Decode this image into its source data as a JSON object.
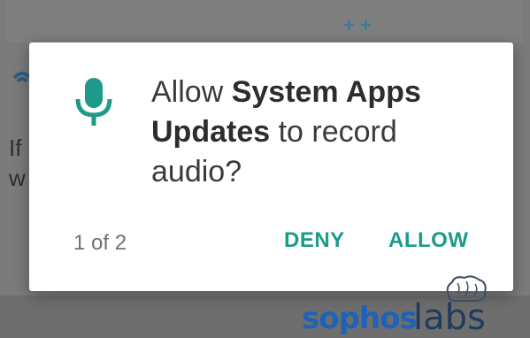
{
  "background": {
    "plus_signs": "+ +",
    "text_line1": "If",
    "text_line2": "w"
  },
  "dialog": {
    "message_prefix": "Allow ",
    "app_name": "System Apps Updates",
    "message_suffix": " to record audio?",
    "counter": "1 of 2",
    "deny_label": "DENY",
    "allow_label": "ALLOW",
    "icon": "microphone-icon",
    "accent_color": "#1d9a8a"
  },
  "watermark": {
    "brand": "SOPHOS",
    "suffix": "labs",
    "icon": "brain-icon"
  }
}
